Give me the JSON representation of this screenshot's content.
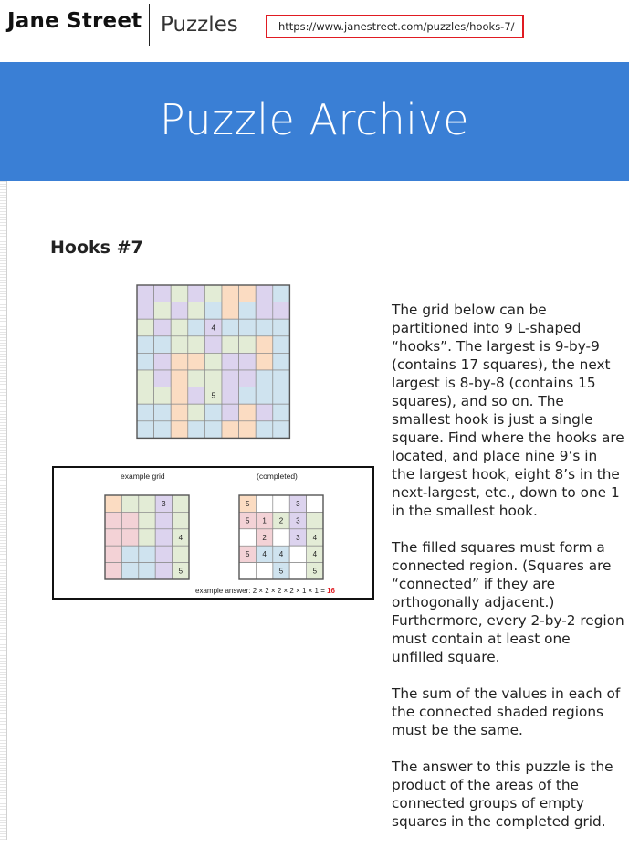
{
  "header": {
    "brand": "Jane Street",
    "section": "Puzzles",
    "url": "https://www.janestreet.com/puzzles/hooks-7/"
  },
  "banner": {
    "title": "Puzzle Archive"
  },
  "puzzle": {
    "title": "Hooks #7"
  },
  "grid": {
    "size": 9,
    "colors": {
      "P": "#dcd3ee",
      "L": "#e3ecd6",
      "B": "#cfe3ef",
      "O": "#fbdcc2",
      "R": "#f3d2d6"
    },
    "cells": [
      "PPLPLOOPB",
      "PLPLBOBPP",
      "LPLBPBBBB",
      "BBLLPLLOB",
      "BPOOLPPOB",
      "LPOLLPPBB",
      "LLOPLPBBB",
      "BBOLBPOPB",
      "BBOBBOOBB"
    ],
    "givens": [
      {
        "row": 2,
        "col": 4,
        "value": "4"
      },
      {
        "row": 6,
        "col": 4,
        "value": "5"
      }
    ]
  },
  "example": {
    "caption_left": "example grid",
    "caption_right": "(completed)",
    "answer_prefix": "example answer: 2 × 2 × 2 × 2 × 1 × 1 = ",
    "answer_value": "16",
    "cells": [
      "OLLPL",
      "RRLPL",
      "RRLPL",
      "RBBPL",
      "RBBPL"
    ],
    "givens": [
      {
        "row": 0,
        "col": 3,
        "value": "3"
      },
      {
        "row": 2,
        "col": 4,
        "value": "4"
      },
      {
        "row": 4,
        "col": 4,
        "value": "5"
      }
    ],
    "completed": [
      {
        "row": 0,
        "col": 0,
        "value": "5"
      },
      {
        "row": 0,
        "col": 3,
        "value": "3"
      },
      {
        "row": 1,
        "col": 0,
        "value": "5"
      },
      {
        "row": 1,
        "col": 1,
        "value": "1"
      },
      {
        "row": 1,
        "col": 2,
        "value": "2"
      },
      {
        "row": 1,
        "col": 3,
        "value": "3"
      },
      {
        "row": 2,
        "col": 1,
        "value": "2"
      },
      {
        "row": 2,
        "col": 3,
        "value": "3"
      },
      {
        "row": 2,
        "col": 4,
        "value": "4"
      },
      {
        "row": 3,
        "col": 0,
        "value": "5"
      },
      {
        "row": 3,
        "col": 1,
        "value": "4"
      },
      {
        "row": 3,
        "col": 2,
        "value": "4"
      },
      {
        "row": 3,
        "col": 4,
        "value": "4"
      },
      {
        "row": 4,
        "col": 2,
        "value": "5"
      },
      {
        "row": 4,
        "col": 4,
        "value": "5"
      }
    ],
    "empty": [
      {
        "row": 0,
        "col": 1
      },
      {
        "row": 0,
        "col": 2
      },
      {
        "row": 0,
        "col": 4
      },
      {
        "row": 2,
        "col": 0
      },
      {
        "row": 2,
        "col": 2
      },
      {
        "row": 3,
        "col": 3
      },
      {
        "row": 4,
        "col": 0
      },
      {
        "row": 4,
        "col": 1
      },
      {
        "row": 4,
        "col": 3
      }
    ]
  },
  "description": [
    "The grid below can be partitioned into 9 L-shaped “hooks”. The largest is 9-by-9 (contains 17 squares), the next largest is 8-by-8 (contains 15 squares), and so on. The smallest hook is just a single square. Find where the hooks are located, and place nine 9’s in the largest hook, eight 8’s in the next-largest, etc., down to one 1 in the smallest hook.",
    "The filled squares must form a connected region. (Squares are “connected” if they are orthogonally adjacent.) Furthermore, every 2-by-2 region must contain at least one unfilled square.",
    "The sum of the values in each of the connected shaded regions must be the same.",
    "The answer to this puzzle is the product of the areas of the connected groups of empty squares in the completed grid."
  ]
}
